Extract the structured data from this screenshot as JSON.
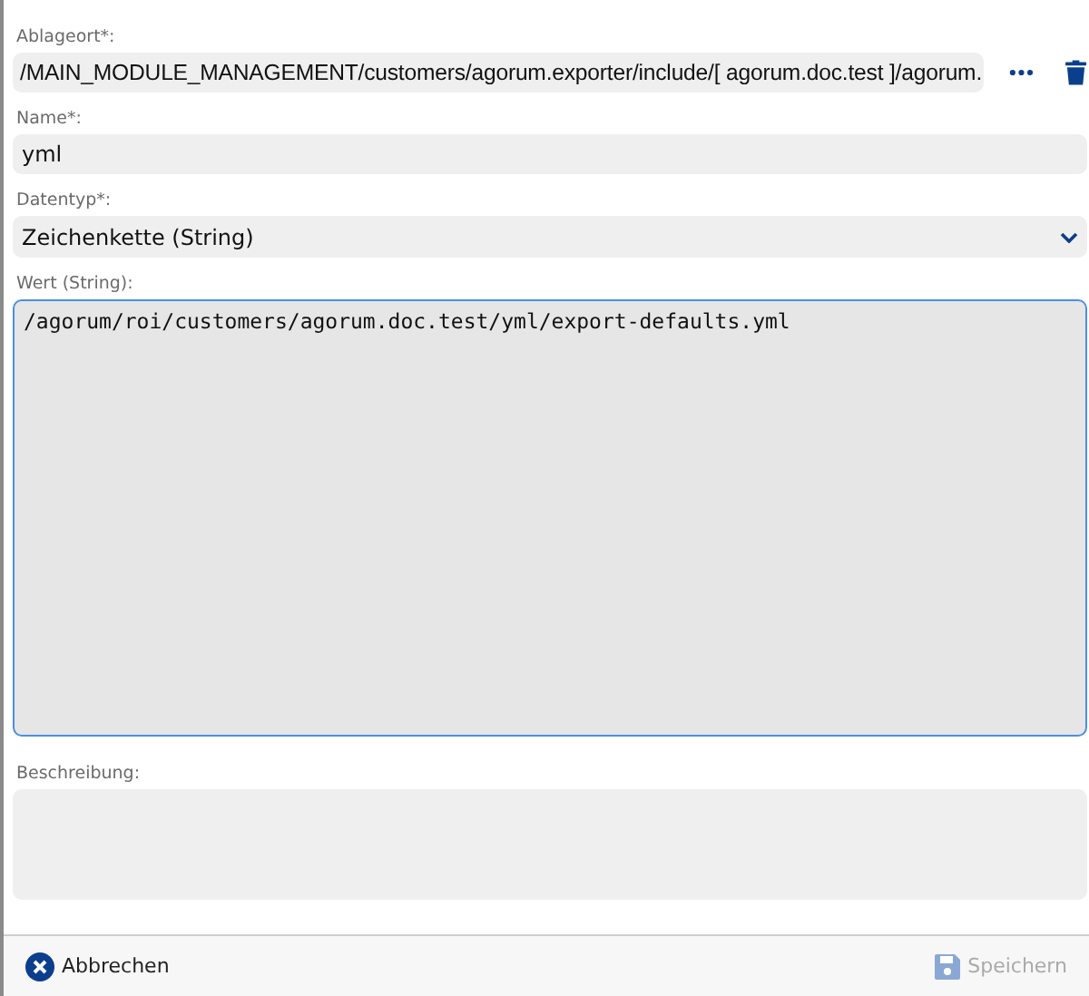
{
  "fields": [
    {
      "kind": "path",
      "label": "Ablageort*:",
      "value": "/MAIN_MODULE_MANAGEMENT/customers/agorum.exporter/include/[ agorum.doc.test ]/agorum."
    },
    {
      "kind": "text",
      "label": "Name*:",
      "value": "yml"
    },
    {
      "kind": "select",
      "label": "Datentyp*:",
      "value": "Zeichenkette (String)"
    },
    {
      "kind": "code",
      "label": "Wert (String):",
      "value": "/agorum/roi/customers/agorum.doc.test/yml/export-defaults.yml"
    },
    {
      "kind": "area",
      "label": "Beschreibung:"
    }
  ],
  "buttons": [
    {
      "kind": "cancel",
      "label": "Abbrechen",
      "disabled": false
    },
    {
      "kind": "save",
      "label": "Speichern",
      "disabled": true
    }
  ]
}
